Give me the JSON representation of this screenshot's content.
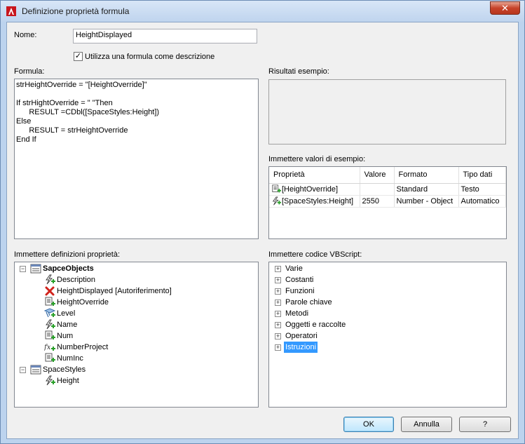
{
  "window": {
    "title": "Definizione proprietà formula",
    "close_label": "✕"
  },
  "name_field": {
    "label": "Nome:",
    "value": "HeightDisplayed"
  },
  "use_formula_checkbox": {
    "label": "Utilizza una formula come descrizione",
    "checked": "✓"
  },
  "formula": {
    "label": "Formula:",
    "lines": [
      "strHeightOverride = \"[HeightOverride]\"",
      "",
      "If strHightOverride = \" \"Then",
      "      RESULT =CDbl([SpaceStyles:Height])",
      "Else",
      "      RESULT = strHeightOverride",
      "End If"
    ]
  },
  "sample_results": {
    "label": "Risultati esempio:"
  },
  "sample_values": {
    "label": "Immettere valori di esempio:",
    "columns": [
      "Proprietà",
      "Valore",
      "Formato",
      "Tipo dati"
    ],
    "rows": [
      {
        "icon": "property-data-icon",
        "property": "[HeightOverride]",
        "value": "",
        "format": "Standard",
        "type": "Testo"
      },
      {
        "icon": "automatic-property-icon",
        "property": "[SpaceStyles:Height]",
        "value": "2550",
        "format": "Number - Object",
        "type": "Automatico"
      }
    ]
  },
  "property_definitions": {
    "label": "Immettere definizioni proprietà:",
    "groups": [
      {
        "name": "SapceObjects",
        "bold": true,
        "items": [
          {
            "label": "Description",
            "icon": "automatic-property-icon"
          },
          {
            "label": "HeightDisplayed [Autoriferimento]",
            "icon": "red-x-icon"
          },
          {
            "label": "HeightOverride",
            "icon": "property-data-icon"
          },
          {
            "label": "Level",
            "icon": "location-property-icon"
          },
          {
            "label": "Name",
            "icon": "automatic-property-icon"
          },
          {
            "label": "Num",
            "icon": "property-data-icon"
          },
          {
            "label": "NumberProject",
            "icon": "formula-property-icon"
          },
          {
            "label": "NumInc",
            "icon": "property-data-icon"
          }
        ]
      },
      {
        "name": "SpaceStyles",
        "bold": false,
        "items": [
          {
            "label": "Height",
            "icon": "automatic-property-icon"
          }
        ]
      }
    ]
  },
  "vbscript": {
    "label": "Immettere codice VBScript:",
    "items": [
      "Varie",
      "Costanti",
      "Funzioni",
      "Parole chiave",
      "Metodi",
      "Oggetti e raccolte",
      "Operatori",
      "Istruzioni"
    ],
    "selected": "Istruzioni"
  },
  "buttons": {
    "ok": "OK",
    "cancel": "Annulla",
    "help": "?"
  },
  "colors": {
    "selection": "#3399ff",
    "window_frame": "#bcd3ee"
  }
}
